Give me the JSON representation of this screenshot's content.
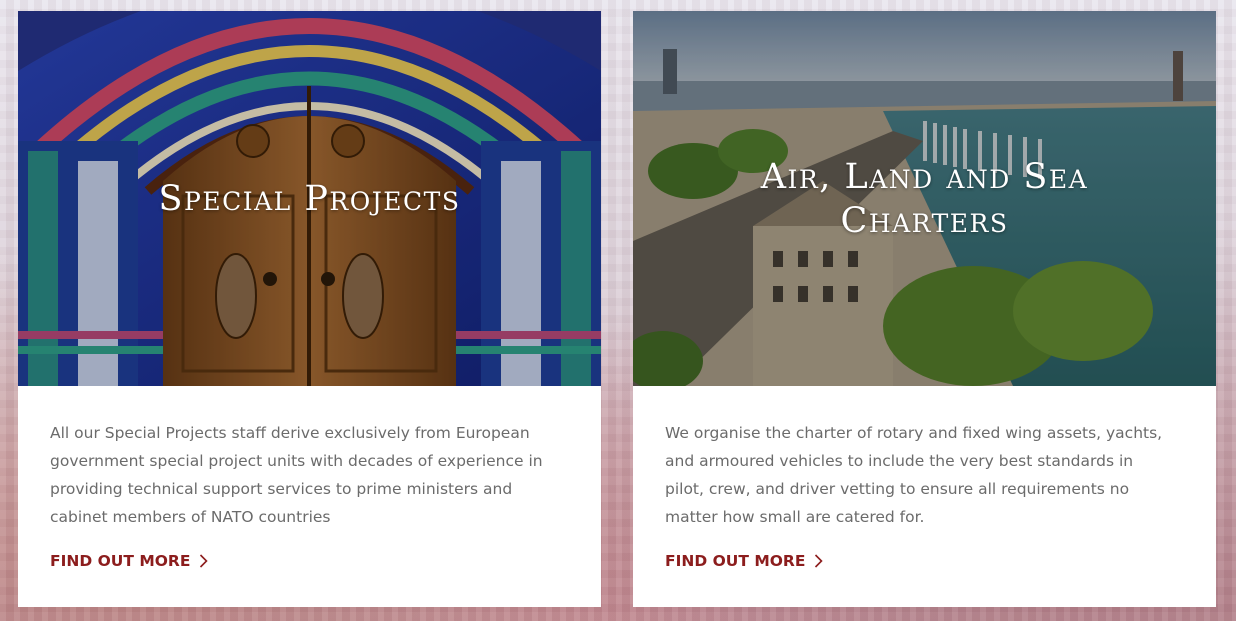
{
  "cards": [
    {
      "title": "Special Projects",
      "description": "All our Special Projects staff derive exclusively from European government special project units with decades of experience in providing technical support services to prime ministers and cabinet members of NATO countries",
      "cta_label": "FIND OUT MORE",
      "image": "ornate-wooden-door"
    },
    {
      "title_line1": "Air, Land and Sea",
      "title_line2": "Charters",
      "description": "We organise the charter of rotary and fixed wing assets, yachts, and armoured vehicles to include the very best standards in pilot, crew, and driver vetting to ensure all requirements no matter how small are catered for.",
      "cta_label": "FIND OUT MORE",
      "image": "harbour-city-aerial"
    }
  ],
  "colors": {
    "accent": "#8c1d1d",
    "body_text": "#6b6b6b",
    "card_bg": "#ffffff"
  },
  "icons": {
    "cta": "chevron-right-icon"
  }
}
